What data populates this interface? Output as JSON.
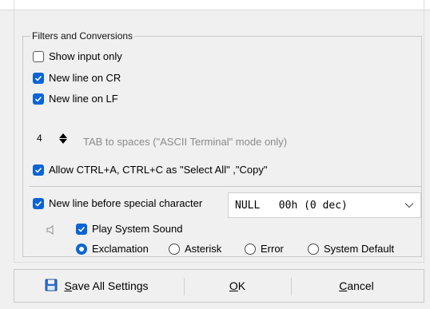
{
  "group": {
    "title": "Filters and Conversions"
  },
  "checkboxes": {
    "show_input_only": {
      "label": "Show input only",
      "checked": false
    },
    "new_line_cr": {
      "label": "New line on CR",
      "checked": true
    },
    "new_line_lf": {
      "label": "New line on LF",
      "checked": true
    },
    "allow_ctrl": {
      "label": "Allow CTRL+A, CTRL+C as \"Select All\" ,\"Copy\"",
      "checked": true
    },
    "new_line_special": {
      "label": "New line before special character",
      "checked": true
    },
    "play_sound": {
      "label": "Play System Sound",
      "checked": true
    }
  },
  "tab_spaces": {
    "value": "4",
    "label": "TAB to spaces (\"ASCII Terminal\" mode only)"
  },
  "special_char_select": {
    "value": "NULL   00h (0 dec)"
  },
  "sound_options": [
    {
      "label": "Exclamation",
      "selected": true
    },
    {
      "label": "Asterisk",
      "selected": false
    },
    {
      "label": "Error",
      "selected": false
    },
    {
      "label": "System Default",
      "selected": false
    }
  ],
  "buttons": {
    "save": "Save All Settings",
    "ok": "OK",
    "cancel": "Cancel"
  },
  "icons": {
    "speaker": "speaker-icon",
    "save": "floppy-disk-icon",
    "checkmark": "checkmark-icon",
    "chevron": "chevron-down-icon"
  },
  "colors": {
    "accent": "#0a64d6",
    "background": "#f0f0f0",
    "disabled_text": "#8a8a8a"
  }
}
